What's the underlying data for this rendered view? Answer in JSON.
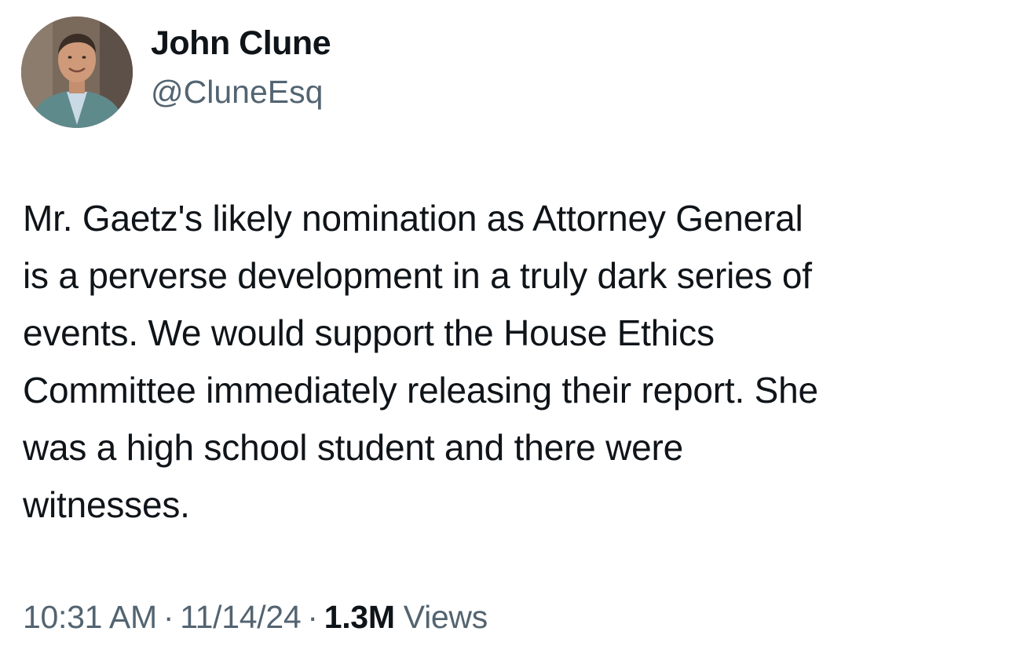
{
  "author": {
    "display_name": "John Clune",
    "handle": "@CluneEsq",
    "avatar_icon": "person-photo-avatar"
  },
  "tweet": {
    "lines": [
      "Mr. Gaetz's likely nomination as Attorney General",
      "is a perverse development in a truly dark series of",
      "events. We would support the House Ethics",
      "Committee immediately releasing their report. She",
      "was a high school student and there were",
      "witnesses."
    ]
  },
  "meta": {
    "time": "10:31 AM",
    "separator": "·",
    "date": "11/14/24",
    "views_count": "1.3M",
    "views_label": "Views"
  },
  "colors": {
    "text_primary": "#0f1419",
    "text_secondary": "#536471",
    "background": "#ffffff"
  }
}
